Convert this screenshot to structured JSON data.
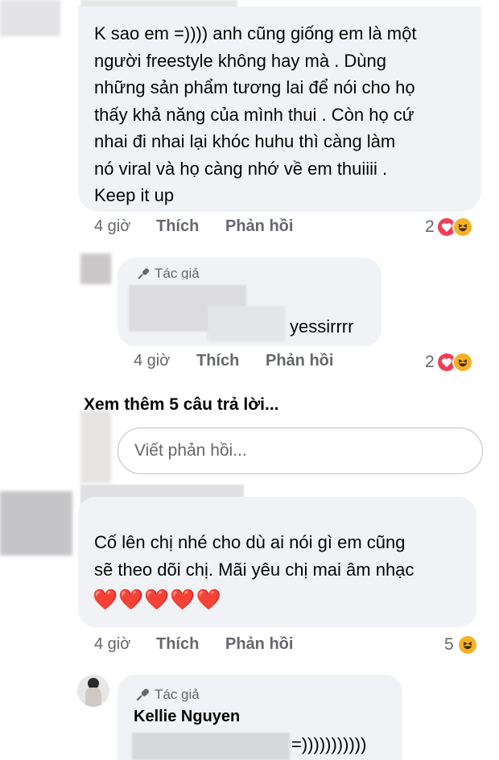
{
  "comments": [
    {
      "text": "K sao em =)))) anh cũng giống em là một\nngười freestyle không hay mà . Dùng\nnhững sản phẩm tương lai để nói cho họ\nthấy khả năng của mình thui . Còn họ cứ\nnhai đi nhai lại khóc huhu thì càng làm\nnó viral và họ càng nhớ về em thuiiii .\nKeep it up",
      "time": "4 giờ",
      "like": "Thích",
      "reply": "Phản hồi",
      "reactions": "2"
    },
    {
      "author_badge": "Tác giả",
      "text": "yessirrrr",
      "time": "4 giờ",
      "like": "Thích",
      "reply": "Phản hồi",
      "reactions": "2"
    },
    {
      "text": "Cố lên chị nhé cho dù ai nói gì em cũng\nsẽ theo dõi chị. Mãi yêu chị mai âm nhạc",
      "hearts": "❤️❤️❤️❤️❤️",
      "time": "4 giờ",
      "like": "Thích",
      "reply": "Phản hồi",
      "reactions": "5"
    },
    {
      "author_badge": "Tác giả",
      "author_name": "Kellie Nguyen",
      "text": "=)))))))))))"
    }
  ],
  "see_more": "Xem thêm 5 câu trả lời...",
  "reply_placeholder": "Viết phản hồi...",
  "icons": {
    "heart": "heart-reaction-icon",
    "haha": "haha-reaction-icon",
    "mic": "microphone-icon"
  },
  "colors": {
    "bubble": "#f0f2f5",
    "meta": "#65676b",
    "heart": "#f33e58",
    "haha": "#f7b125"
  }
}
